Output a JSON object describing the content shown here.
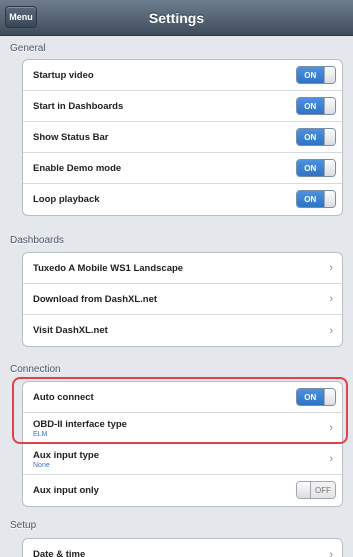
{
  "navbar": {
    "menu_label": "Menu",
    "title": "Settings"
  },
  "sections": {
    "general": {
      "header": "General",
      "rows": [
        {
          "label": "Startup video",
          "toggle": "ON"
        },
        {
          "label": "Start in Dashboards",
          "toggle": "ON"
        },
        {
          "label": "Show Status Bar",
          "toggle": "ON"
        },
        {
          "label": "Enable Demo mode",
          "toggle": "ON"
        },
        {
          "label": "Loop playback",
          "toggle": "ON"
        }
      ]
    },
    "dashboards": {
      "header": "Dashboards",
      "rows": [
        {
          "label": "Tuxedo A Mobile WS1 Landscape",
          "chevron": "›"
        },
        {
          "label": "Download from DashXL.net",
          "chevron": "›"
        },
        {
          "label": "Visit DashXL.net",
          "chevron": "›"
        }
      ]
    },
    "connection": {
      "header": "Connection",
      "rows": [
        {
          "label": "Auto connect",
          "toggle": "ON"
        },
        {
          "label": "OBD-II interface type",
          "value": "ELM",
          "chevron": "›"
        },
        {
          "label": "Aux input type",
          "value": "None",
          "chevron": "›"
        },
        {
          "label": "Aux input only",
          "toggle": "OFF"
        }
      ]
    },
    "setup": {
      "header": "Setup",
      "rows": [
        {
          "label": "Date & time",
          "chevron": "›"
        }
      ]
    }
  },
  "colors": {
    "toggle_on": "#3a82d6",
    "highlight": "#e0424a"
  }
}
